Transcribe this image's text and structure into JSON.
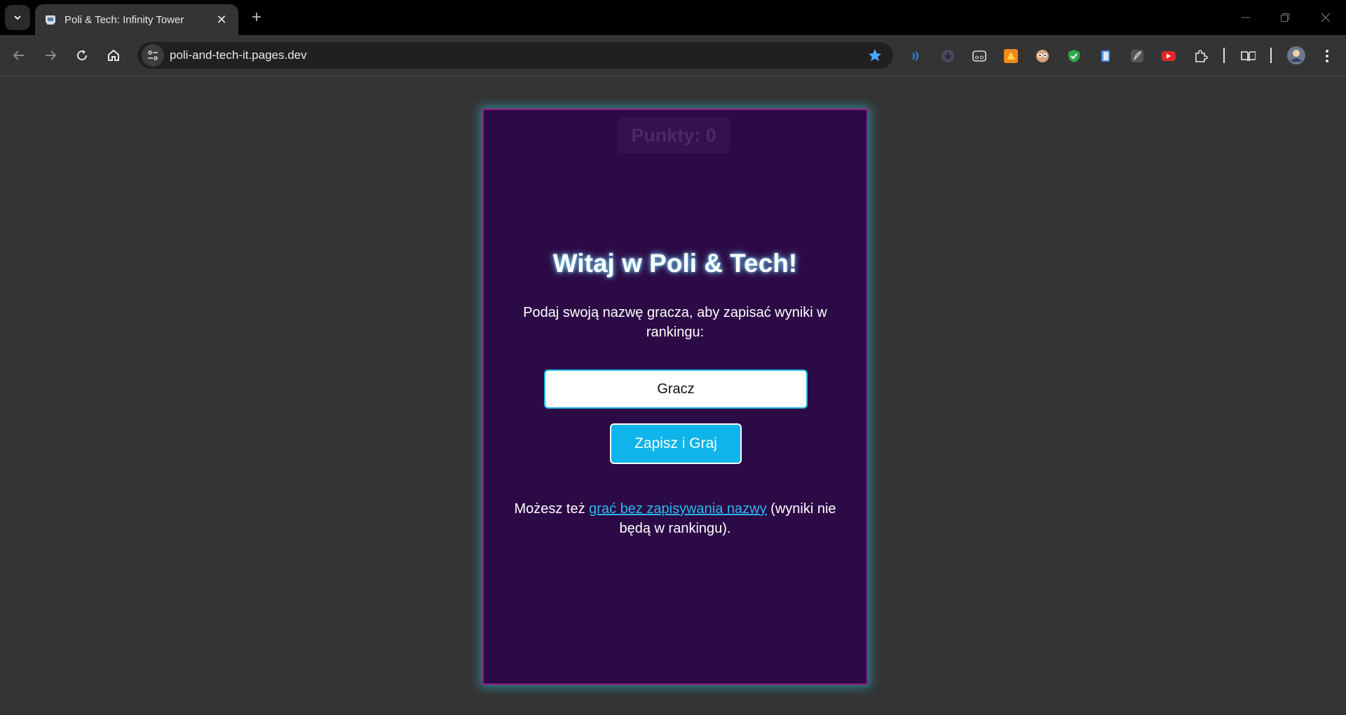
{
  "browser": {
    "tab_title": "Poli & Tech: Infinity Tower",
    "url": "poli-and-tech-it.pages.dev",
    "accent_color": "#4aa8ff"
  },
  "game": {
    "score_label": "Punkty: 0",
    "title": "Witaj w Poli & Tech!",
    "prompt": "Podaj swoją nazwę gracza, aby zapisać wyniki w rankingu:",
    "name_value": "Gracz",
    "save_button": "Zapisz i Graj",
    "alt_prefix": "Możesz też ",
    "alt_link": "grać bez zapisywania nazwy",
    "alt_suffix": " (wyniki nie będą w rankingu).",
    "colors": {
      "panel": "#2c0a45",
      "border": "#9a1c8a",
      "button": "#0eb4ea",
      "link": "#2cb8ee"
    }
  }
}
